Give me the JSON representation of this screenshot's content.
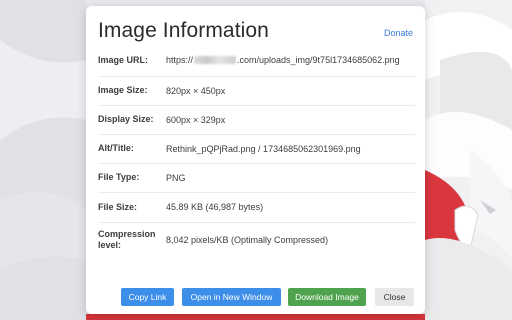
{
  "dialog": {
    "title": "Image Information",
    "donate_label": "Donate",
    "rows": [
      {
        "label": "Image URL:",
        "value_prefix": "https://",
        "value_suffix": ".com/uploads_img/9t75l1734685062.png"
      },
      {
        "label": "Image Size:",
        "value": "820px × 450px"
      },
      {
        "label": "Display Size:",
        "value": "600px × 329px"
      },
      {
        "label": "Alt/Title:",
        "value": "Rethink_pQPjRad.png / 1734685062301969.png"
      },
      {
        "label": "File Type:",
        "value": "PNG"
      },
      {
        "label": "File Size:",
        "value": "45.89 KB (46,987 bytes)"
      },
      {
        "label": "Compression level:",
        "value": "8,042 pixels/KB (Optimally Compressed)"
      }
    ],
    "buttons": {
      "copy_link": "Copy Link",
      "open_new_window": "Open in New Window",
      "download_image": "Download Image",
      "close": "Close"
    }
  },
  "colors": {
    "primary_button": "#3d8ee8",
    "download_button": "#4fa34f",
    "close_button": "#e7e7e7",
    "link": "#3b7cd9"
  }
}
